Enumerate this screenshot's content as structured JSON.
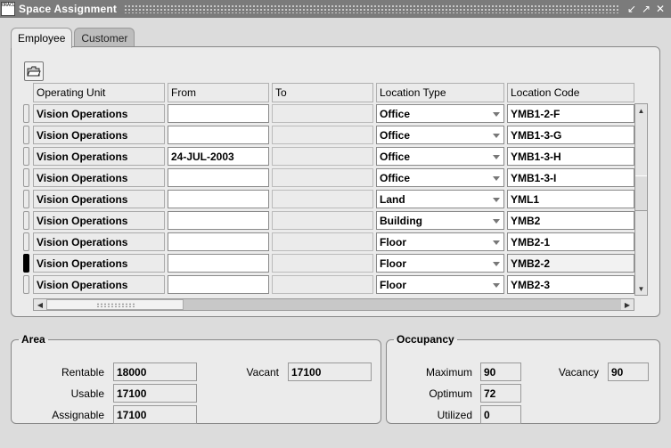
{
  "window": {
    "title": "Space Assignment",
    "app_icon_text": "ORACLE"
  },
  "tabs": [
    {
      "label": "Employee",
      "active": true
    },
    {
      "label": "Customer",
      "active": false
    }
  ],
  "table": {
    "columns": [
      "Operating Unit",
      "From",
      "To",
      "Location Type",
      "Location Code"
    ],
    "rows": [
      {
        "operating_unit": "Vision Operations",
        "from": "",
        "to": "",
        "location_type": "Office",
        "location_code": "YMB1-2-F"
      },
      {
        "operating_unit": "Vision Operations",
        "from": "",
        "to": "",
        "location_type": "Office",
        "location_code": "YMB1-3-G"
      },
      {
        "operating_unit": "Vision Operations",
        "from": "24-JUL-2003",
        "to": "",
        "location_type": "Office",
        "location_code": "YMB1-3-H"
      },
      {
        "operating_unit": "Vision Operations",
        "from": "",
        "to": "",
        "location_type": "Office",
        "location_code": "YMB1-3-I"
      },
      {
        "operating_unit": "Vision Operations",
        "from": "",
        "to": "",
        "location_type": "Land",
        "location_code": "YML1"
      },
      {
        "operating_unit": "Vision Operations",
        "from": "",
        "to": "",
        "location_type": "Building",
        "location_code": "YMB2"
      },
      {
        "operating_unit": "Vision Operations",
        "from": "",
        "to": "",
        "location_type": "Floor",
        "location_code": "YMB2-1"
      },
      {
        "operating_unit": "Vision Operations",
        "from": "",
        "to": "",
        "location_type": "Floor",
        "location_code": "YMB2-2"
      },
      {
        "operating_unit": "Vision Operations",
        "from": "",
        "to": "",
        "location_type": "Floor",
        "location_code": "YMB2-3"
      }
    ],
    "current_row": 7
  },
  "area": {
    "title": "Area",
    "rentable_label": "Rentable",
    "rentable": "18000",
    "usable_label": "Usable",
    "usable": "17100",
    "assignable_label": "Assignable",
    "assignable": "17100",
    "vacant_label": "Vacant",
    "vacant": "17100"
  },
  "occupancy": {
    "title": "Occupancy",
    "maximum_label": "Maximum",
    "maximum": "90",
    "optimum_label": "Optimum",
    "optimum": "72",
    "utilized_label": "Utilized",
    "utilized": "0",
    "vacancy_label": "Vacancy",
    "vacancy": "90"
  },
  "colors": {
    "titlebar": "#7b7b7b",
    "window_bg": "#dcdcdc",
    "panel_bg": "#ebebeb"
  }
}
